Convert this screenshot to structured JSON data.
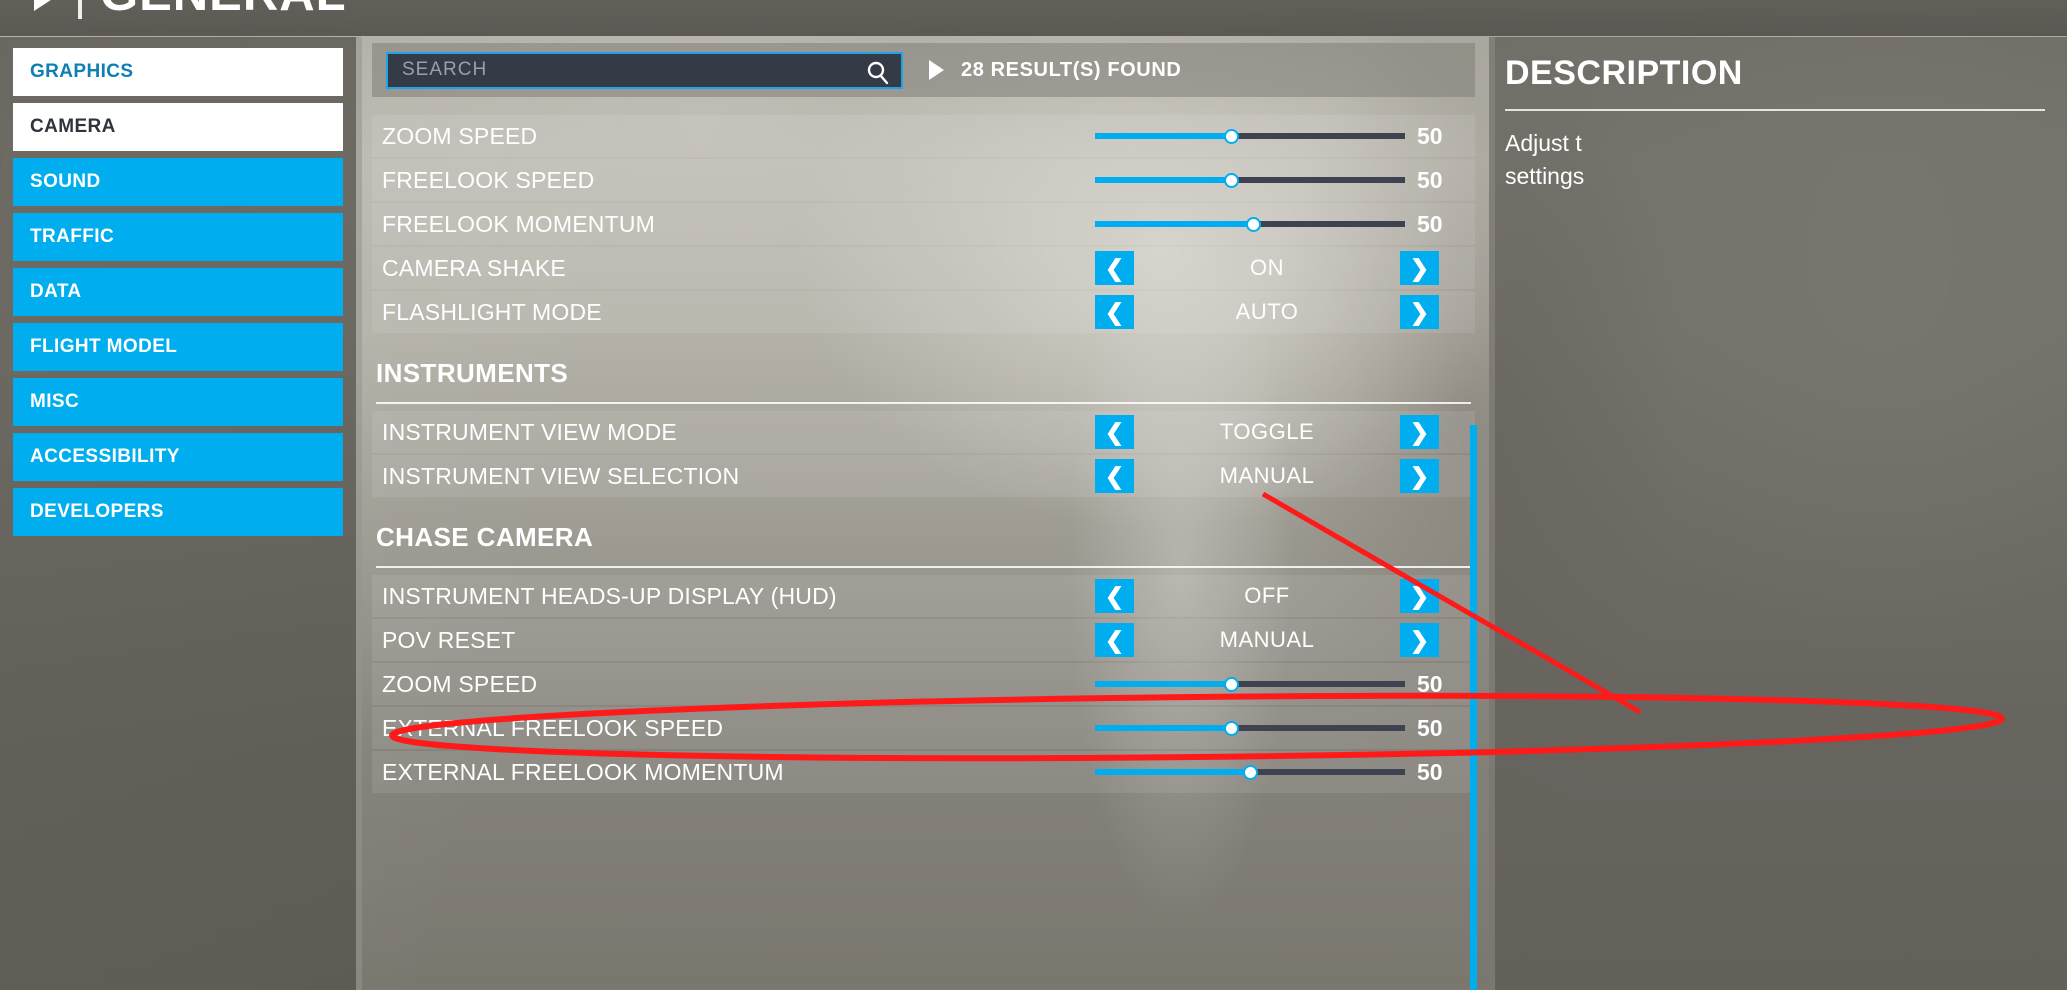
{
  "header": {
    "chevron_icon": "play-chevron-icon",
    "title": "GENERAL"
  },
  "sidebar": {
    "items": [
      {
        "label": "GRAPHICS",
        "style": "white-accent"
      },
      {
        "label": "CAMERA",
        "style": "white-dark"
      },
      {
        "label": "SOUND",
        "style": "blue"
      },
      {
        "label": "TRAFFIC",
        "style": "blue"
      },
      {
        "label": "DATA",
        "style": "blue"
      },
      {
        "label": "FLIGHT MODEL",
        "style": "blue"
      },
      {
        "label": "MISC",
        "style": "blue"
      },
      {
        "label": "ACCESSIBILITY",
        "style": "blue"
      },
      {
        "label": "DEVELOPERS",
        "style": "blue"
      }
    ]
  },
  "search": {
    "value": "",
    "placeholder": "SEARCH",
    "icon": "search-icon",
    "results_chevron_icon": "chevron-right-icon",
    "results_text": "28 RESULT(S) FOUND",
    "results_count": 28
  },
  "settings": {
    "rows": [
      {
        "kind": "slider",
        "label": "ZOOM SPEED",
        "value": "50",
        "percent": 44
      },
      {
        "kind": "slider",
        "label": "FREELOOK SPEED",
        "value": "50",
        "percent": 44
      },
      {
        "kind": "slider",
        "label": "FREELOOK MOMENTUM",
        "value": "50",
        "percent": 51
      },
      {
        "kind": "selector",
        "label": "CAMERA SHAKE",
        "value": "ON"
      },
      {
        "kind": "selector",
        "label": "FLASHLIGHT MODE",
        "value": "AUTO"
      },
      {
        "kind": "section",
        "label": "INSTRUMENTS"
      },
      {
        "kind": "selector",
        "label": "INSTRUMENT VIEW MODE",
        "value": "TOGGLE"
      },
      {
        "kind": "selector",
        "label": "INSTRUMENT VIEW SELECTION",
        "value": "MANUAL"
      },
      {
        "kind": "section",
        "label": "CHASE CAMERA"
      },
      {
        "kind": "selector",
        "label": "INSTRUMENT HEADS-UP DISPLAY (HUD)",
        "value": "OFF",
        "highlighted": true
      },
      {
        "kind": "selector",
        "label": "POV RESET",
        "value": "MANUAL"
      },
      {
        "kind": "slider",
        "label": "ZOOM SPEED",
        "value": "50",
        "percent": 44
      },
      {
        "kind": "slider",
        "label": "EXTERNAL FREELOOK SPEED",
        "value": "50",
        "percent": 44
      },
      {
        "kind": "slider",
        "label": "EXTERNAL FREELOOK MOMENTUM",
        "value": "50",
        "percent": 50
      }
    ],
    "arrow_left_icon": "chevron-left-icon",
    "arrow_right_icon": "chevron-right-icon"
  },
  "description": {
    "title": "DESCRIPTION",
    "body": "Adjust t\nsettings"
  },
  "annotation": {
    "color": "#ff1a1a",
    "shapes": [
      "ellipse-around-hud-row",
      "arrow-to-hud-right-button"
    ]
  },
  "colors": {
    "accent_blue": "#00aeef",
    "sidebar_text_accent": "#0e7fb5",
    "search_field_bg": "#343b46",
    "search_border": "#1ba5e8",
    "slider_track": "#3d4350",
    "annotation_red": "#ff1a1a"
  }
}
